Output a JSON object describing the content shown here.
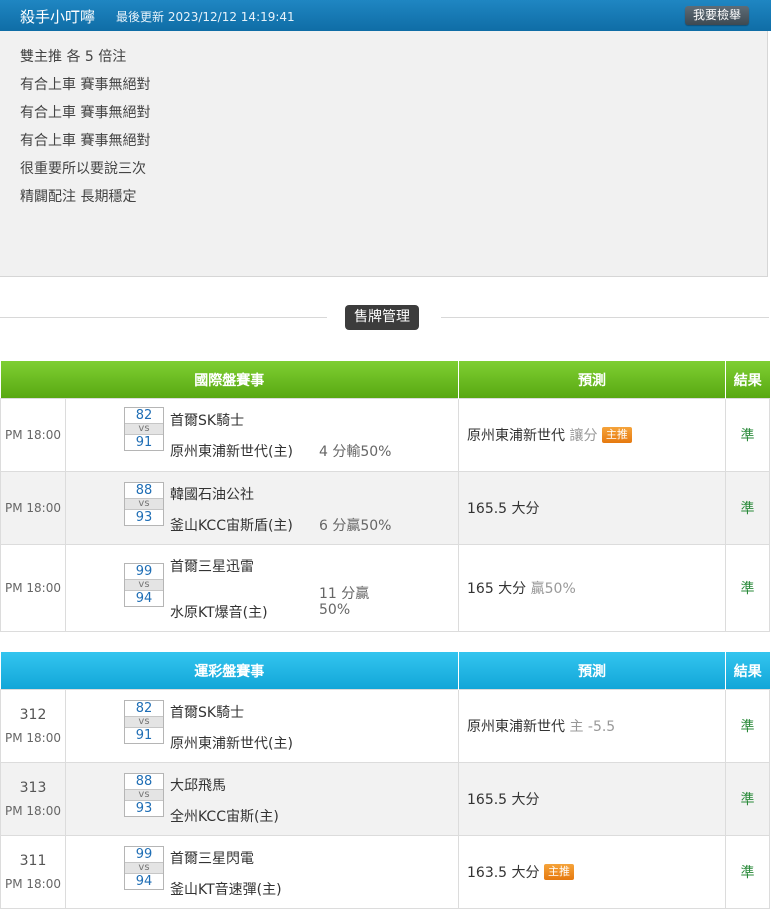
{
  "header": {
    "title": "殺手小叮嚀",
    "updated": "最後更新 2023/12/12 14:19:41",
    "report_btn": "我要檢舉"
  },
  "notes": [
    "雙主推 各 5 倍注",
    "有合上車 賽事無絕對",
    "有合上車 賽事無絕對",
    "有合上車 賽事無絕對",
    "很重要所以要說三次",
    "精闢配注 長期穩定"
  ],
  "sell_btn": "售牌管理",
  "colors": {
    "green": "#6cbf22",
    "blue": "#1fb5e3",
    "orange": "#ee8a1f",
    "result": "#2a8a3a"
  },
  "intl": {
    "headers": {
      "match": "國際盤賽事",
      "pred": "預測",
      "result": "結果"
    },
    "rows": [
      {
        "time": "PM 18:00",
        "s1": "82",
        "vs": "vs",
        "s2": "91",
        "team1": "首爾SK騎士",
        "team2": "原州東浦新世代(主)",
        "hcp": "4 分輸50%",
        "pred": "原州東浦新世代",
        "pred_extra": "讓分",
        "badge": "主推",
        "result": "準"
      },
      {
        "time": "PM 18:00",
        "s1": "88",
        "vs": "vs",
        "s2": "93",
        "team1": "韓國石油公社",
        "team2": "釜山KCC宙斯盾(主)",
        "hcp": "6 分贏50%",
        "pred": "165.5 大分",
        "pred_extra": "",
        "result": "準"
      },
      {
        "time": "PM 18:00",
        "s1": "99",
        "vs": "vs",
        "s2": "94",
        "team1": "首爾三星迅雷",
        "team2": "水原KT爆音(主)",
        "hcp1": "11 分贏",
        "hcp2": "50%",
        "pred": "165 大分",
        "pred_extra": "贏50%",
        "result": "準"
      }
    ]
  },
  "lottery": {
    "headers": {
      "match": "運彩盤賽事",
      "pred": "預測",
      "result": "結果"
    },
    "rows": [
      {
        "no": "312",
        "time": "PM 18:00",
        "s1": "82",
        "vs": "vs",
        "s2": "91",
        "team1": "首爾SK騎士",
        "team2": "原州東浦新世代(主)",
        "pred": "原州東浦新世代",
        "pred_extra": "主 -5.5",
        "result": "準"
      },
      {
        "no": "313",
        "time": "PM 18:00",
        "s1": "88",
        "vs": "vs",
        "s2": "93",
        "team1": "大邱飛馬",
        "team2": "全州KCC宙斯(主)",
        "pred": "165.5 大分",
        "pred_extra": "",
        "result": "準"
      },
      {
        "no": "311",
        "time": "PM 18:00",
        "s1": "99",
        "vs": "vs",
        "s2": "94",
        "team1": "首爾三星閃電",
        "team2": "釜山KT音速彈(主)",
        "pred": "163.5 大分",
        "badge": "主推",
        "result": "準"
      }
    ]
  }
}
